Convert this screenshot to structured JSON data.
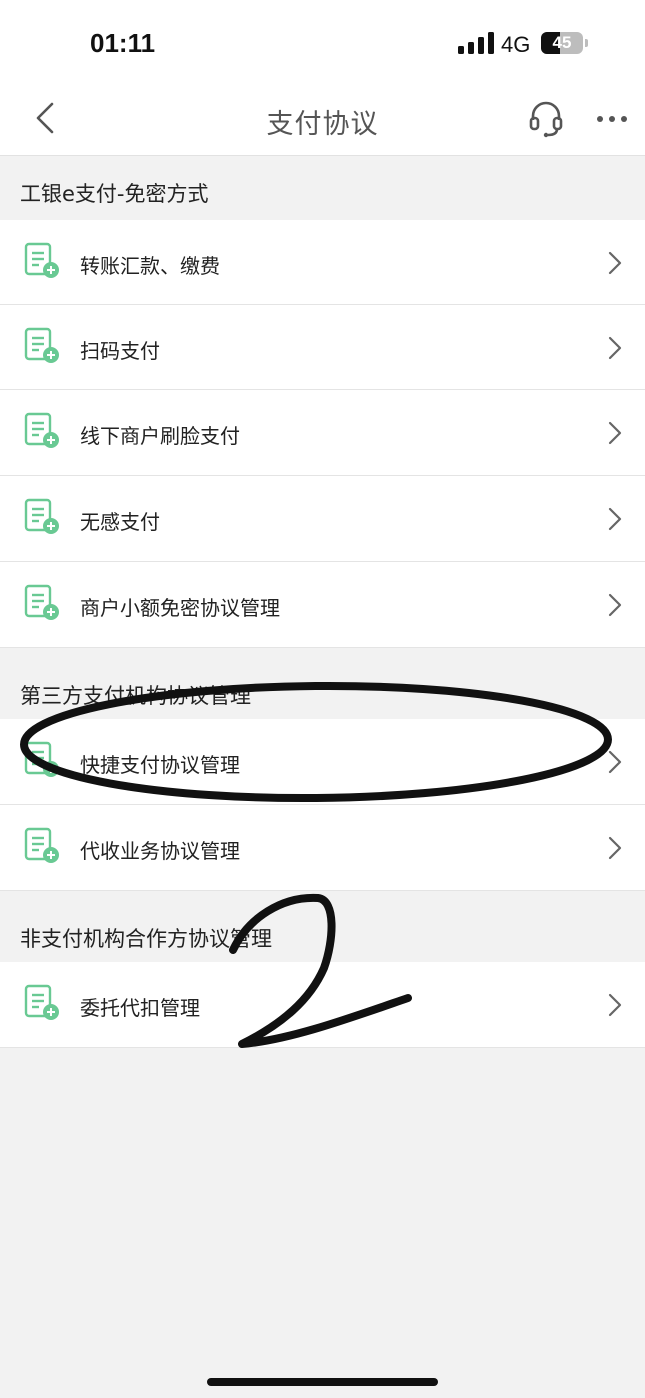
{
  "status_bar": {
    "time": "01:11",
    "network": "4G",
    "battery": "45",
    "battery_level": 0.45
  },
  "nav": {
    "title": "支付协议",
    "back_icon": "chevron-left-icon",
    "service_icon": "headset-icon",
    "more_icon": "more-icon"
  },
  "sections": [
    {
      "title": "工银e支付-免密方式",
      "items": [
        {
          "label": "转账汇款、缴费"
        },
        {
          "label": "扫码支付"
        },
        {
          "label": "线下商户刷脸支付"
        },
        {
          "label": "无感支付"
        },
        {
          "label": "商户小额免密协议管理"
        }
      ]
    },
    {
      "title": "第三方支付机构协议管理",
      "items": [
        {
          "label": "快捷支付协议管理"
        },
        {
          "label": "代收业务协议管理"
        }
      ]
    },
    {
      "title": "非支付机构合作方协议管理",
      "items": [
        {
          "label": "委托代扣管理"
        }
      ]
    }
  ],
  "icons": {
    "item_icon": "document-add-icon",
    "chevron": "chevron-right-icon"
  },
  "colors": {
    "accent": "#69c993",
    "background": "#f2f2f2",
    "ink": "#111111"
  }
}
